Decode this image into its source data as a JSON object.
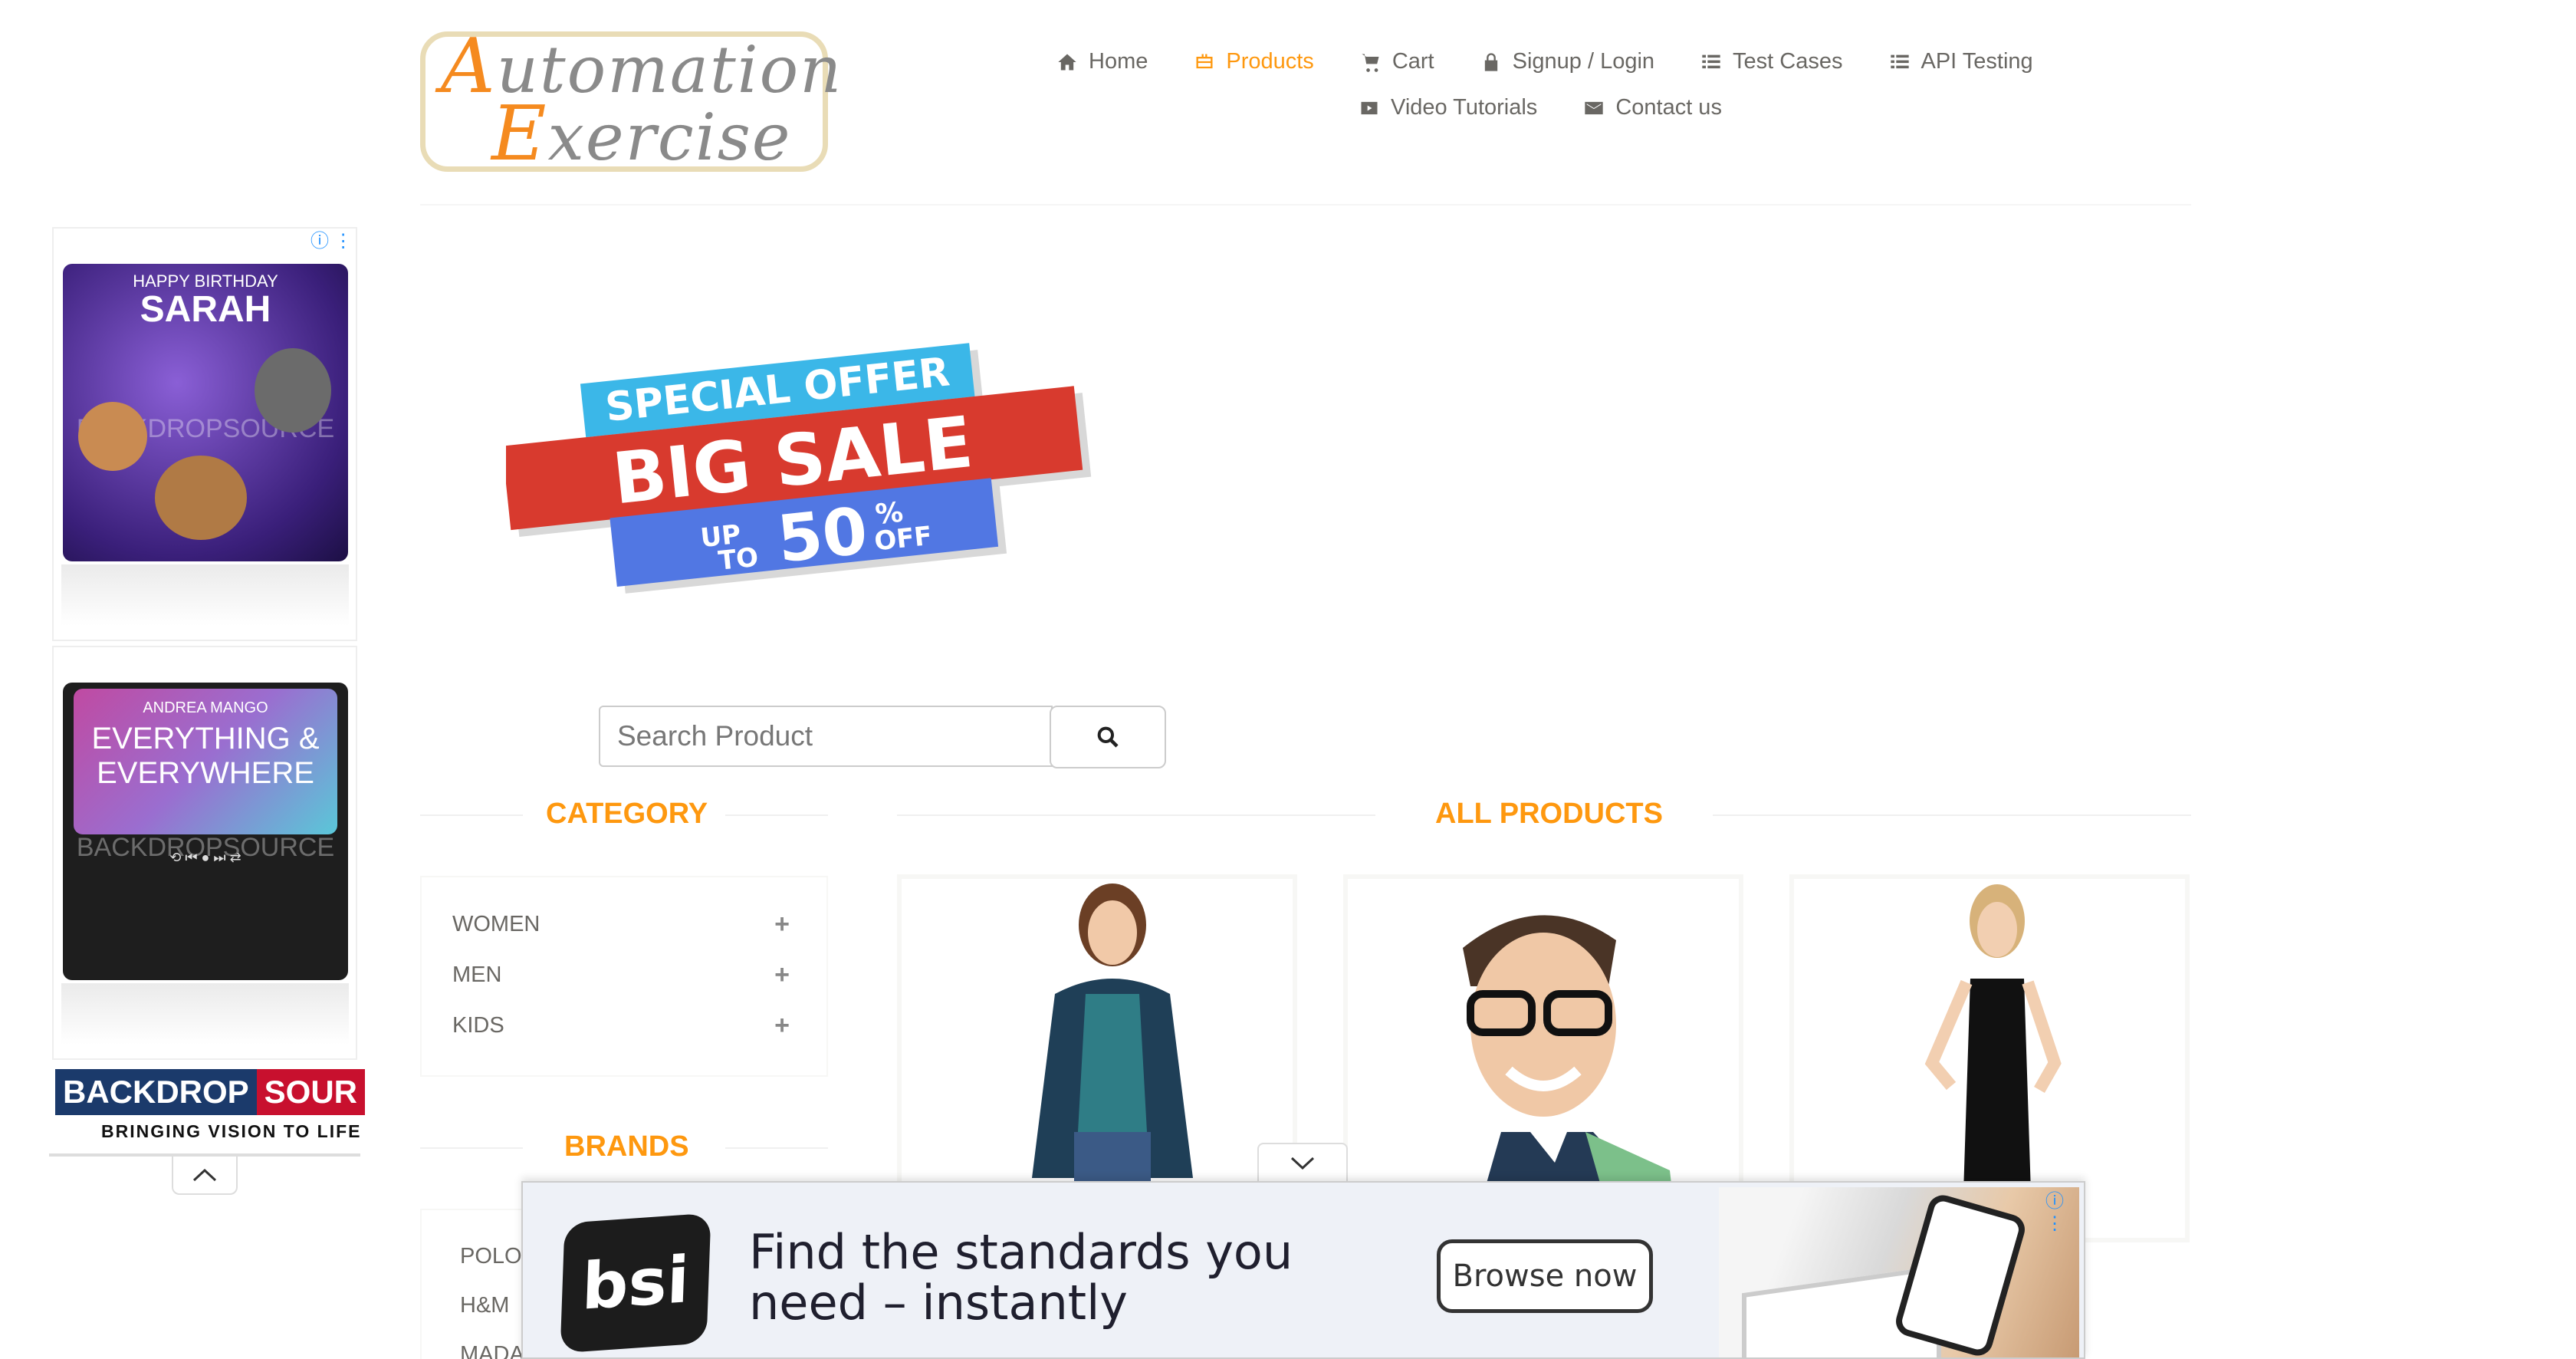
{
  "logo": {
    "line1_cap": "A",
    "line1_rest": "utomation",
    "line2_cap": "E",
    "line2_rest": "xercise"
  },
  "nav": {
    "row1": [
      {
        "label": "Home",
        "icon": "home-icon"
      },
      {
        "label": "Products",
        "icon": "products-icon",
        "active": true
      },
      {
        "label": "Cart",
        "icon": "cart-icon"
      },
      {
        "label": "Signup / Login",
        "icon": "lock-icon"
      },
      {
        "label": "Test Cases",
        "icon": "list-icon"
      },
      {
        "label": "API Testing",
        "icon": "list-icon"
      }
    ],
    "row2": [
      {
        "label": "Video Tutorials",
        "icon": "youtube-icon"
      },
      {
        "label": "Contact us",
        "icon": "envelope-icon"
      }
    ]
  },
  "left_ads": {
    "ad1": {
      "small": "HAPPY BIRTHDAY",
      "big": "SARAH",
      "watermark": "BACKDROPSOURCE"
    },
    "ad2": {
      "small": "ANDREA MANGO",
      "big1": "EVERYTHING &",
      "big2": "EVERYWHERE",
      "watermark": "BACKDROPSOURCE"
    },
    "brand_left": "BACKDROP",
    "brand_right": "SOUR",
    "tagline": "BRINGING VISION TO LIFE"
  },
  "banner": {
    "line1": "SPECIAL OFFER",
    "line2": "BIG SALE",
    "upto1": "UP",
    "upto2": "TO",
    "percent": "50",
    "pct_sign": "%",
    "off": "OFF"
  },
  "search": {
    "placeholder": "Search Product"
  },
  "category": {
    "title": "Category",
    "items": [
      {
        "label": "WOMEN"
      },
      {
        "label": "MEN"
      },
      {
        "label": "KIDS"
      }
    ]
  },
  "brands": {
    "title": "Brands",
    "items": [
      "POLO",
      "H&M",
      "MADA"
    ]
  },
  "products": {
    "title": "All Products"
  },
  "bottom_ad": {
    "brand": "bsi",
    "line1": "Find the standards you",
    "line2": "need – instantly",
    "cta": "Browse now"
  },
  "colors": {
    "accent": "#fe980f",
    "nav_text": "#696763",
    "ad_bg": "#eef1f7"
  }
}
